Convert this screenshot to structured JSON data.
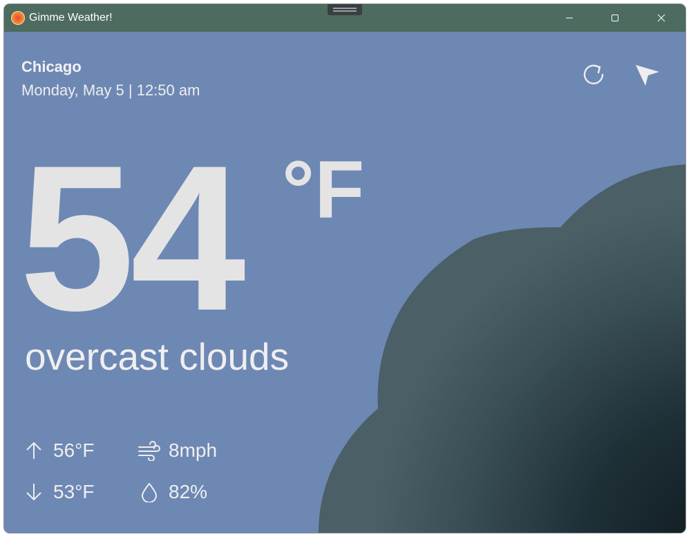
{
  "window": {
    "title": "Gimme Weather!",
    "controls": [
      "minimize",
      "maximize",
      "close"
    ]
  },
  "location": {
    "city": "Chicago",
    "datetime": "Monday, May 5 | 12:50 am"
  },
  "actions": {
    "refresh_icon": "refresh-icon",
    "locate_icon": "navigation-arrow-icon"
  },
  "weather": {
    "temperature": "54",
    "unit": "°F",
    "condition": "overcast clouds",
    "high": "56°F",
    "low": "53°F",
    "wind": "8mph",
    "humidity": "82%"
  },
  "colors": {
    "titlebar": "#4d6b5f",
    "background": "#6e88b4",
    "cloud": "#455a62",
    "text": "#e4e4e4"
  }
}
